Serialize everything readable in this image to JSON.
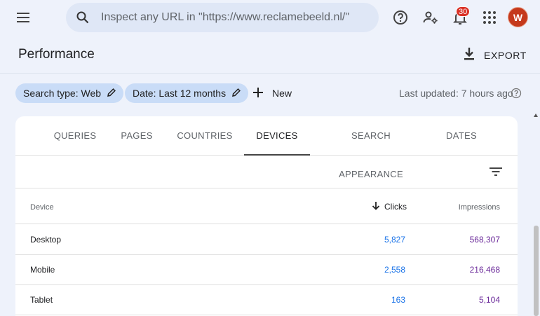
{
  "topbar": {
    "search_placeholder": "Inspect any URL in \"https://www.reclamebeeld.nl/\"",
    "notification_count": "30",
    "avatar_initial": "W"
  },
  "header": {
    "title": "Performance",
    "export_label": "EXPORT"
  },
  "filters": {
    "chips": [
      {
        "label": "Search type: Web"
      },
      {
        "label": "Date: Last 12 months"
      }
    ],
    "new_label": "New",
    "last_updated": "Last updated: 7 hours ago"
  },
  "tabs": [
    {
      "label": "QUERIES",
      "active": false
    },
    {
      "label": "PAGES",
      "active": false
    },
    {
      "label": "COUNTRIES",
      "active": false
    },
    {
      "label": "DEVICES",
      "active": true
    },
    {
      "label": "SEARCH APPEARANCE",
      "active": false
    },
    {
      "label": "DATES",
      "active": false
    }
  ],
  "table": {
    "columns": {
      "device": "Device",
      "clicks": "Clicks",
      "impressions": "Impressions"
    },
    "sort": {
      "column": "clicks",
      "direction": "descending"
    },
    "rows": [
      {
        "device": "Desktop",
        "clicks": "5,827",
        "impressions": "568,307"
      },
      {
        "device": "Mobile",
        "clicks": "2,558",
        "impressions": "216,468"
      },
      {
        "device": "Tablet",
        "clicks": "163",
        "impressions": "5,104"
      }
    ]
  },
  "icons": {
    "menu": "menu-icon",
    "search": "search-icon",
    "help": "help-icon",
    "settings": "manage-accounts-icon",
    "notifications": "bell-icon",
    "apps": "apps-grid-icon",
    "export": "download-icon",
    "edit": "pencil-icon",
    "add": "plus-icon",
    "filter": "filter-icon",
    "sort": "arrow-down-icon"
  },
  "colors": {
    "background": "#eef2fb",
    "chip": "#c9dcf7",
    "clicks": "#1a73e8",
    "impressions": "#6b2a9a",
    "avatar": "#c5391c",
    "badge": "#d93025"
  }
}
